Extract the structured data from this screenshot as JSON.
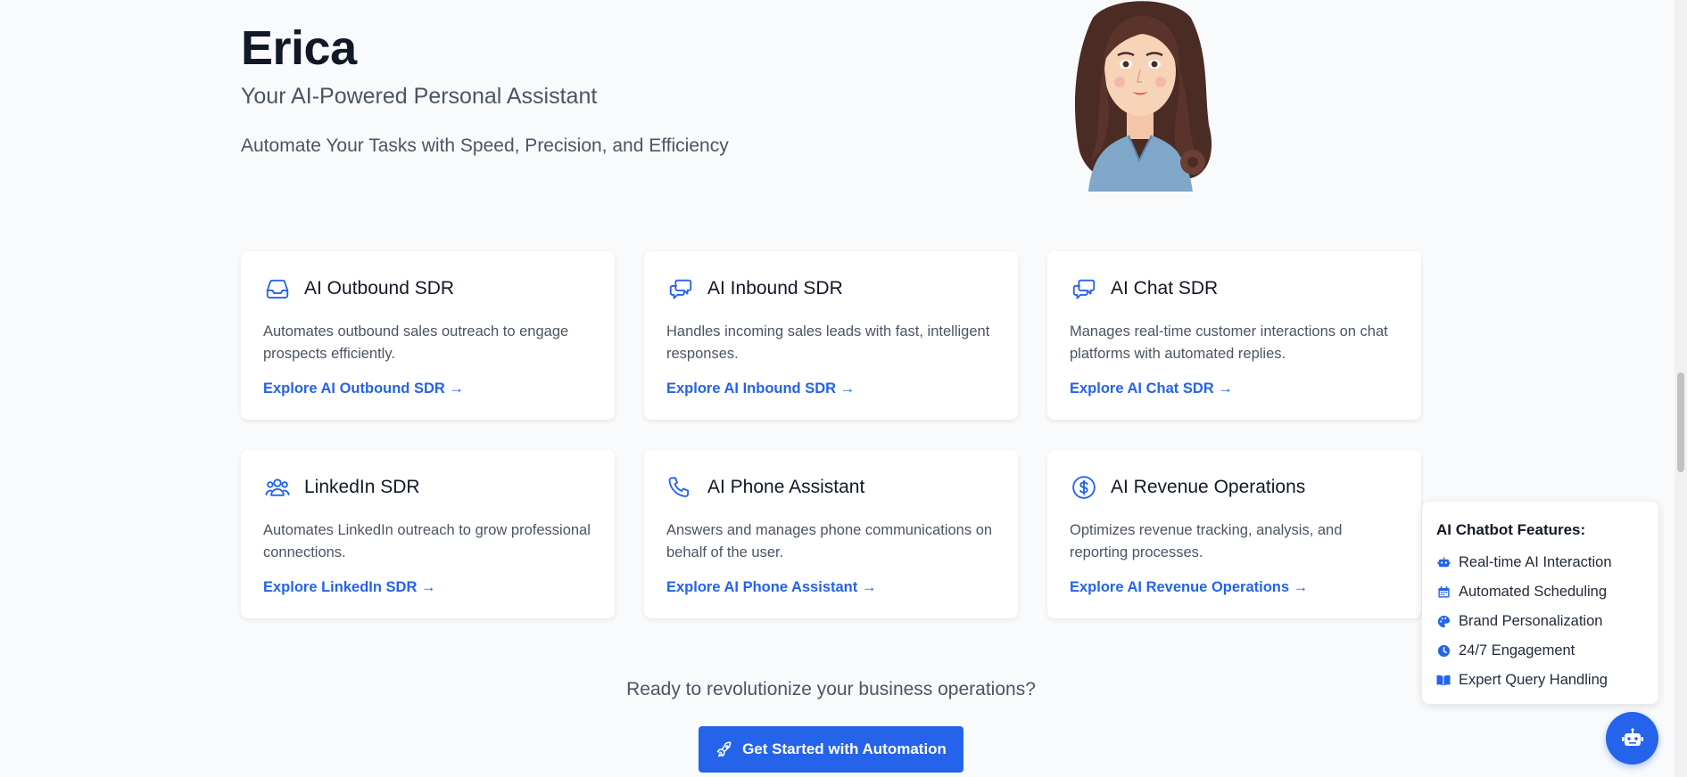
{
  "hero": {
    "title": "Erica",
    "subtitle": "Your AI-Powered Personal Assistant",
    "tagline": "Automate Your Tasks with Speed, Precision, and Efficiency"
  },
  "cards": [
    {
      "icon": "inbox-icon",
      "title": "AI Outbound SDR",
      "description": "Automates outbound sales outreach to engage prospects efficiently.",
      "link": "Explore AI Outbound SDR →"
    },
    {
      "icon": "chat-bubbles-icon",
      "title": "AI Inbound SDR",
      "description": "Handles incoming sales leads with fast, intelligent responses.",
      "link": "Explore AI Inbound SDR →"
    },
    {
      "icon": "chat-bubbles-icon",
      "title": "AI Chat SDR",
      "description": "Manages real-time customer interactions on chat platforms with automated replies.",
      "link": "Explore AI Chat SDR →"
    },
    {
      "icon": "users-icon",
      "title": "LinkedIn SDR",
      "description": "Automates LinkedIn outreach to grow professional connections.",
      "link": "Explore LinkedIn SDR →"
    },
    {
      "icon": "phone-icon",
      "title": "AI Phone Assistant",
      "description": "Answers and manages phone communications on behalf of the user.",
      "link": "Explore AI Phone Assistant →"
    },
    {
      "icon": "dollar-circle-icon",
      "title": "AI Revenue Operations",
      "description": "Optimizes revenue tracking, analysis, and reporting processes.",
      "link": "Explore AI Revenue Operations →"
    }
  ],
  "cta": {
    "text": "Ready to revolutionize your business operations?",
    "button_label": "Get Started with Automation"
  },
  "features_popup": {
    "title": "AI Chatbot Features:",
    "items": [
      {
        "icon": "robot-icon",
        "label": "Real-time AI Interaction"
      },
      {
        "icon": "calendar-icon",
        "label": "Automated Scheduling"
      },
      {
        "icon": "palette-icon",
        "label": "Brand Personalization"
      },
      {
        "icon": "clock-icon",
        "label": "24/7 Engagement"
      },
      {
        "icon": "book-icon",
        "label": "Expert Query Handling"
      }
    ]
  },
  "colors": {
    "accent": "#2563eb",
    "text_dark": "#111827",
    "text_muted": "#4b5563",
    "background": "#f8fafc"
  }
}
